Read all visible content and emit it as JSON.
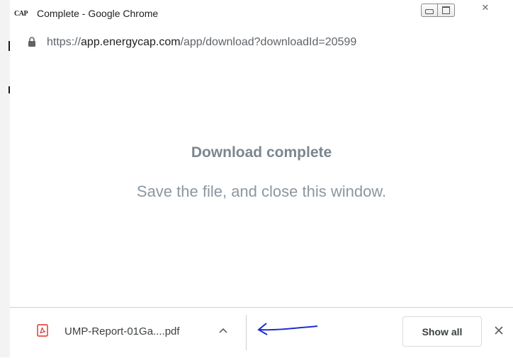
{
  "window": {
    "app_logo": "CAP",
    "title": "Complete - Google Chrome",
    "close_glyph": "✕"
  },
  "address": {
    "url_scheme": "https://",
    "url_domain": "app.energycap.com",
    "url_path": "/app/download?downloadId=20599"
  },
  "page": {
    "headline": "Download complete",
    "message": "Save the file, and close this window."
  },
  "download_shelf": {
    "file_name": "UMP-Report-01Ga....pdf",
    "show_all_label": "Show all"
  },
  "colors": {
    "pdf_icon": "#d93025",
    "annotation_arrow": "#1f2ccf",
    "headline": "#7b8690"
  },
  "icons": [
    "lock-icon",
    "pdf-file-icon",
    "chevron-up-icon",
    "close-icon",
    "minimize-icon",
    "maximize-icon"
  ]
}
